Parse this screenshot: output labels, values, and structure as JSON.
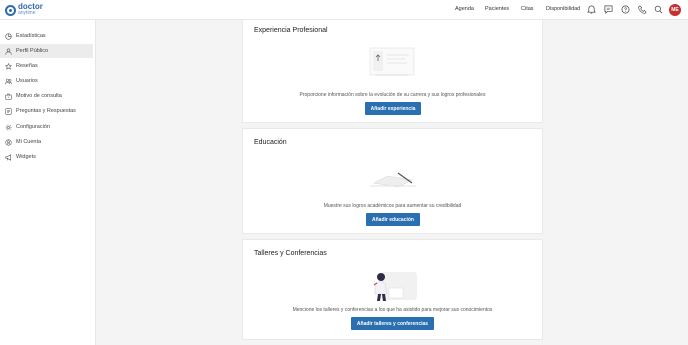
{
  "brand": {
    "name": "doctor",
    "sub": "anytime"
  },
  "nav": {
    "agenda": "Agenda",
    "patients": "Pacientes",
    "appointments": "Citas",
    "availability": "Disponibilidad"
  },
  "user": {
    "initials": "ME"
  },
  "icons": [
    "bell-icon",
    "chat-icon",
    "help-icon",
    "phone-icon",
    "search-icon"
  ],
  "sidebar": {
    "items": [
      {
        "label": "Estadísticas",
        "icon": "chart-icon"
      },
      {
        "label": "Perfil Público",
        "icon": "user-icon",
        "active": true
      },
      {
        "label": "Reseñas",
        "icon": "star-icon"
      },
      {
        "label": "Usuarios",
        "icon": "users-icon"
      },
      {
        "label": "Motivo de consulta",
        "icon": "briefcase-icon"
      },
      {
        "label": "Preguntas y Respuestas",
        "icon": "qa-icon"
      },
      {
        "label": "Configuración",
        "icon": "gear-icon"
      },
      {
        "label": "Mi Cuenta",
        "icon": "account-icon"
      },
      {
        "label": "Widgets",
        "icon": "megaphone-icon"
      }
    ]
  },
  "sections": {
    "experience": {
      "title": "Experiencia Profesional",
      "description": "Proporcione información sobre la evolución de su carrera y sus logros profesionales",
      "button": "Añadir experiencia"
    },
    "education": {
      "title": "Educación",
      "description": "Muestre sus logros académicos para aumentar su credibilidad",
      "button": "Añadir educación"
    },
    "workshops": {
      "title": "Talleres y Conferencias",
      "description": "Mencione los talleres y conferencias a los que ha asistido para mejorar sus conocimientos",
      "button": "Añadir talleres y conferencias"
    }
  },
  "colors": {
    "accent": "#2a6fb0",
    "avatar": "#c53030"
  }
}
